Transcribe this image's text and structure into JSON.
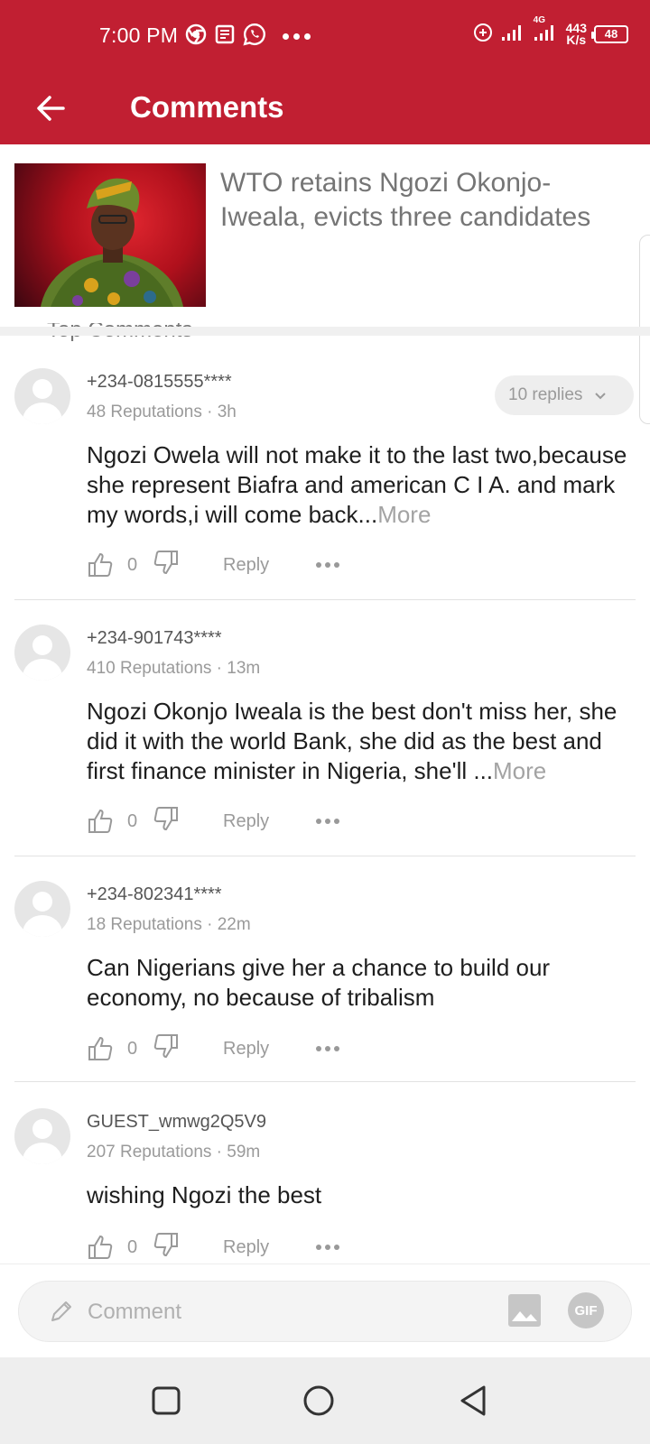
{
  "status_bar": {
    "time": "7:00 PM",
    "network_speed_value": "443",
    "network_speed_unit": "K/s",
    "network_type": "4G",
    "battery": "48",
    "icons": [
      "chrome-icon",
      "news-icon",
      "whatsapp-icon",
      "more-dots-icon",
      "data-saver-icon",
      "signal-icon",
      "signal-4g-icon",
      "battery-icon"
    ]
  },
  "app_bar": {
    "title": "Comments",
    "back_icon": "arrow-left-icon"
  },
  "article": {
    "title": "WTO retains Ngozi Okonjo-Iweala, evicts three candidates"
  },
  "section": {
    "label": "Top Comments"
  },
  "comments": [
    {
      "user": "+234-0815555****",
      "reputation": "48 Reputations",
      "time": "3h",
      "text": "Ngozi Owela will not make it to the last two,because she represent Biafra and american C I A. and mark my words,i will come back...",
      "more": "More",
      "likes": "0",
      "reply_label": "Reply",
      "replies": "10 replies"
    },
    {
      "user": "+234-901743****",
      "reputation": "410 Reputations",
      "time": "13m",
      "text": "Ngozi Okonjo Iweala is the best don't miss her, she did it with the world Bank, she did as the best and first finance minister in Nigeria, she'll ...",
      "more": "More",
      "likes": "0",
      "reply_label": "Reply"
    },
    {
      "user": "+234-802341****",
      "reputation": "18 Reputations",
      "time": "22m",
      "text": "Can Nigerians give her a chance to build our economy, no because of tribalism",
      "likes": "0",
      "reply_label": "Reply"
    },
    {
      "user": "GUEST_wmwg2Q5V9",
      "reputation": "207 Reputations",
      "time": "59m",
      "text": "wishing Ngozi the best",
      "likes": "0",
      "reply_label": "Reply"
    }
  ],
  "meta_separator": "·",
  "composer": {
    "placeholder": "Comment",
    "gif_label": "GIF"
  },
  "colors": {
    "brand_red": "#c11f32",
    "muted_text": "#9a9a9a"
  }
}
